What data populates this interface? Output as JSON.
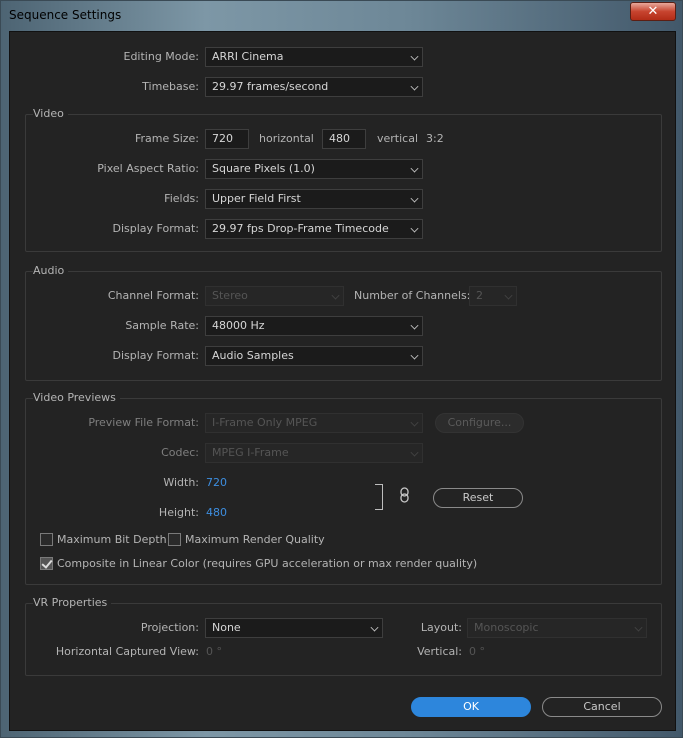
{
  "window": {
    "title": "Sequence Settings",
    "close_glyph": "✕"
  },
  "editing_mode": {
    "label": "Editing Mode:",
    "value": "ARRI Cinema"
  },
  "timebase": {
    "label": "Timebase:",
    "value": "29.97  frames/second"
  },
  "video": {
    "title": "Video",
    "frame_size": {
      "label": "Frame Size:",
      "width": "720",
      "horizontal": "horizontal",
      "height": "480",
      "vertical": "vertical",
      "ratio": "3:2"
    },
    "pixel_aspect": {
      "label": "Pixel Aspect Ratio:",
      "value": "Square Pixels (1.0)"
    },
    "fields": {
      "label": "Fields:",
      "value": "Upper Field First"
    },
    "display_format": {
      "label": "Display Format:",
      "value": "29.97 fps Drop-Frame Timecode"
    }
  },
  "audio": {
    "title": "Audio",
    "channel_format": {
      "label": "Channel Format:",
      "value": "Stereo"
    },
    "num_channels": {
      "label": "Number of Channels:",
      "value": "2"
    },
    "sample_rate": {
      "label": "Sample Rate:",
      "value": "48000 Hz"
    },
    "display_format": {
      "label": "Display Format:",
      "value": "Audio Samples"
    }
  },
  "previews": {
    "title": "Video Previews",
    "file_format": {
      "label": "Preview File Format:",
      "value": "I-Frame Only MPEG"
    },
    "configure": "Configure...",
    "codec": {
      "label": "Codec:",
      "value": "MPEG I-Frame"
    },
    "width": {
      "label": "Width:",
      "value": "720"
    },
    "height": {
      "label": "Height:",
      "value": "480"
    },
    "link_icon": "link-icon",
    "reset": "Reset",
    "max_bit_depth": {
      "label": "Maximum Bit Depth",
      "checked": false
    },
    "max_render_quality": {
      "label": "Maximum Render Quality",
      "checked": false
    },
    "linear_color": {
      "label": "Composite in Linear Color (requires GPU acceleration or max render quality)",
      "checked": true
    }
  },
  "vr": {
    "title": "VR Properties",
    "projection": {
      "label": "Projection:",
      "value": "None"
    },
    "layout": {
      "label": "Layout:",
      "value": "Monoscopic"
    },
    "h_view": {
      "label": "Horizontal Captured View:",
      "value": "0 °"
    },
    "vertical": {
      "label": "Vertical:",
      "value": "0 °"
    }
  },
  "buttons": {
    "ok": "OK",
    "cancel": "Cancel"
  },
  "colors": {
    "accent": "#2d86dc",
    "value_blue": "#3d8ee0",
    "panel_bg": "#232323"
  }
}
